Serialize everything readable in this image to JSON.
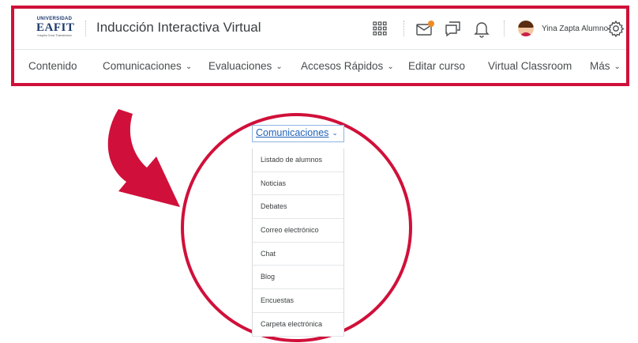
{
  "header": {
    "logo": {
      "line1": "UNIVERSIDAD",
      "line2": "EAFIT",
      "line3": "Inspira Crea Transforma"
    },
    "course_title": "Inducción Interactiva Virtual",
    "user_name": "Yina Zapta Alumno",
    "icons": [
      "grid-icon",
      "mail-icon",
      "chat-icon",
      "bell-icon",
      "gear-icon"
    ],
    "notification_color": "#f08a24"
  },
  "nav": {
    "items": [
      {
        "label": "Contenido",
        "has_menu": false
      },
      {
        "label": "Comunicaciones",
        "has_menu": true
      },
      {
        "label": "Evaluaciones",
        "has_menu": true
      },
      {
        "label": "Accesos Rápidos",
        "has_menu": true
      },
      {
        "label": "Editar curso",
        "has_menu": false
      },
      {
        "label": "Virtual Classroom",
        "has_menu": false
      },
      {
        "label": "Más",
        "has_menu": true
      }
    ]
  },
  "dropdown": {
    "trigger_label": "Comunicaciones",
    "items": [
      "Listado de alumnos",
      "Noticias",
      "Debates",
      "Correo electrónico",
      "Chat",
      "Blog",
      "Encuestas",
      "Carpeta electrónica"
    ]
  },
  "colors": {
    "highlight": "#d0103a",
    "link": "#2062b8",
    "text": "#494c4e"
  }
}
